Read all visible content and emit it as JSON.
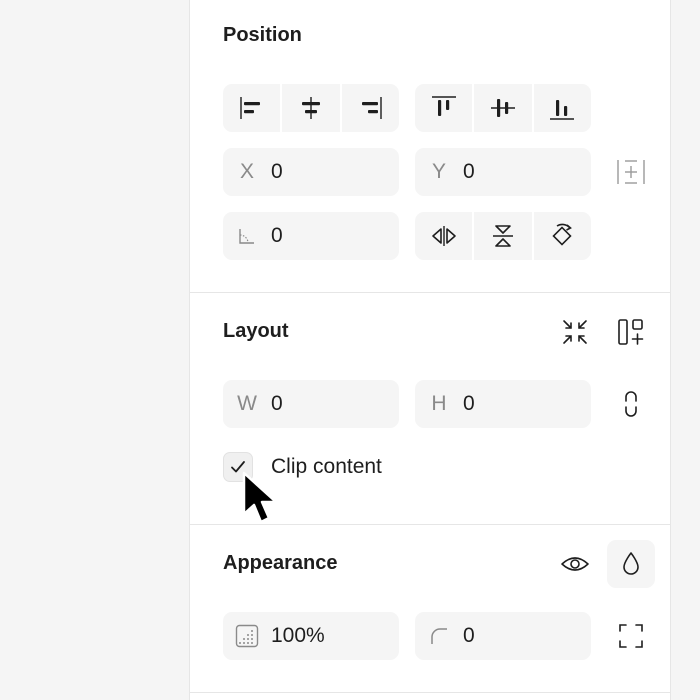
{
  "position": {
    "title": "Position",
    "x": {
      "label": "X",
      "value": "0"
    },
    "y": {
      "label": "Y",
      "value": "0"
    },
    "rotation": {
      "value": "0"
    }
  },
  "layout": {
    "title": "Layout",
    "w": {
      "label": "W",
      "value": "0"
    },
    "h": {
      "label": "H",
      "value": "0"
    },
    "clip_content": {
      "label": "Clip content",
      "checked": true
    }
  },
  "appearance": {
    "title": "Appearance",
    "opacity": {
      "value": "100%"
    },
    "corner_radius": {
      "value": "0"
    }
  },
  "colors": {
    "panel": "#ffffff",
    "field": "#f5f5f5",
    "text": "#1e1e1e",
    "muted": "#8a8a8a",
    "divider": "#e6e6e6"
  }
}
